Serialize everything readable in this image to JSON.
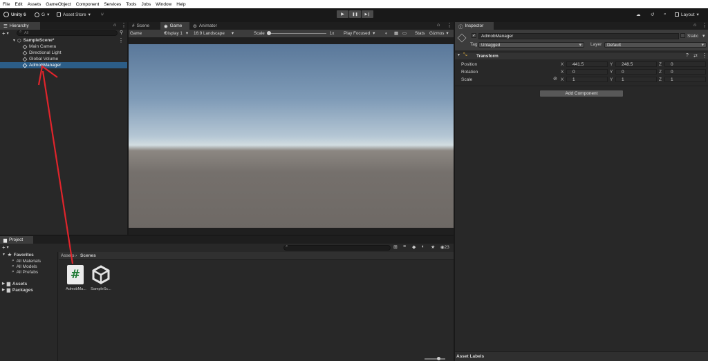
{
  "menu": [
    "File",
    "Edit",
    "Assets",
    "GameObject",
    "Component",
    "Services",
    "Tools",
    "Jobs",
    "Window",
    "Help"
  ],
  "toolbar": {
    "unity_label": "Unity 6",
    "account_label": "G",
    "asset_store_label": "Asset Store",
    "layout_label": "Layout",
    "play_icons": [
      "▶",
      "❚❚",
      "▶❙"
    ]
  },
  "hierarchy": {
    "tab_label": "Hierarchy",
    "search_placeholder": "All",
    "scene_name": "SampleScene*",
    "objects": [
      "Main Camera",
      "Directional Light",
      "Global Volume",
      "AdmobManager"
    ],
    "selected": "AdmobManager"
  },
  "center_tabs": [
    "Scene",
    "Game",
    "Animator"
  ],
  "game_toolbar": {
    "mode": "Game",
    "display": "Display 1",
    "aspect": "16:9 Landscape",
    "scale_label": "Scale",
    "scale_value": "1x",
    "play_focus": "Play Focused",
    "stats": "Stats",
    "gizmos": "Gizmos"
  },
  "inspector": {
    "tab_label": "Inspector",
    "object_name": "AdmobManager",
    "static_label": "Static",
    "tag_label": "Tag",
    "tag_value": "Untagged",
    "layer_label": "Layer",
    "layer_value": "Default",
    "component_title": "Transform",
    "rows": [
      {
        "label": "Position",
        "x": "441.5",
        "y": "248.5",
        "z": "0"
      },
      {
        "label": "Rotation",
        "x": "0",
        "y": "0",
        "z": "0"
      },
      {
        "label": "Scale",
        "x": "1",
        "y": "1",
        "z": "1"
      }
    ],
    "axis_labels": [
      "X",
      "Y",
      "Z"
    ],
    "add_component": "Add Component",
    "asset_labels": "Asset Labels"
  },
  "project": {
    "tab_label": "Project",
    "favorites_label": "Favorites",
    "favorites": [
      "All Materials",
      "All Models",
      "All Prefabs"
    ],
    "roots": [
      "Assets",
      "Packages"
    ],
    "breadcrumb": [
      "Assets",
      "Scenes"
    ],
    "hidden_count": "23",
    "assets": [
      {
        "name": "AdmobMa...",
        "icon": "csharp-script-icon"
      },
      {
        "name": "SampleSc...",
        "icon": "unity-scene-icon"
      }
    ]
  },
  "colors": {
    "selection": "#2c5d87",
    "annotation_arrow": "#e0242b",
    "menubar_bg": "#ffffff"
  }
}
